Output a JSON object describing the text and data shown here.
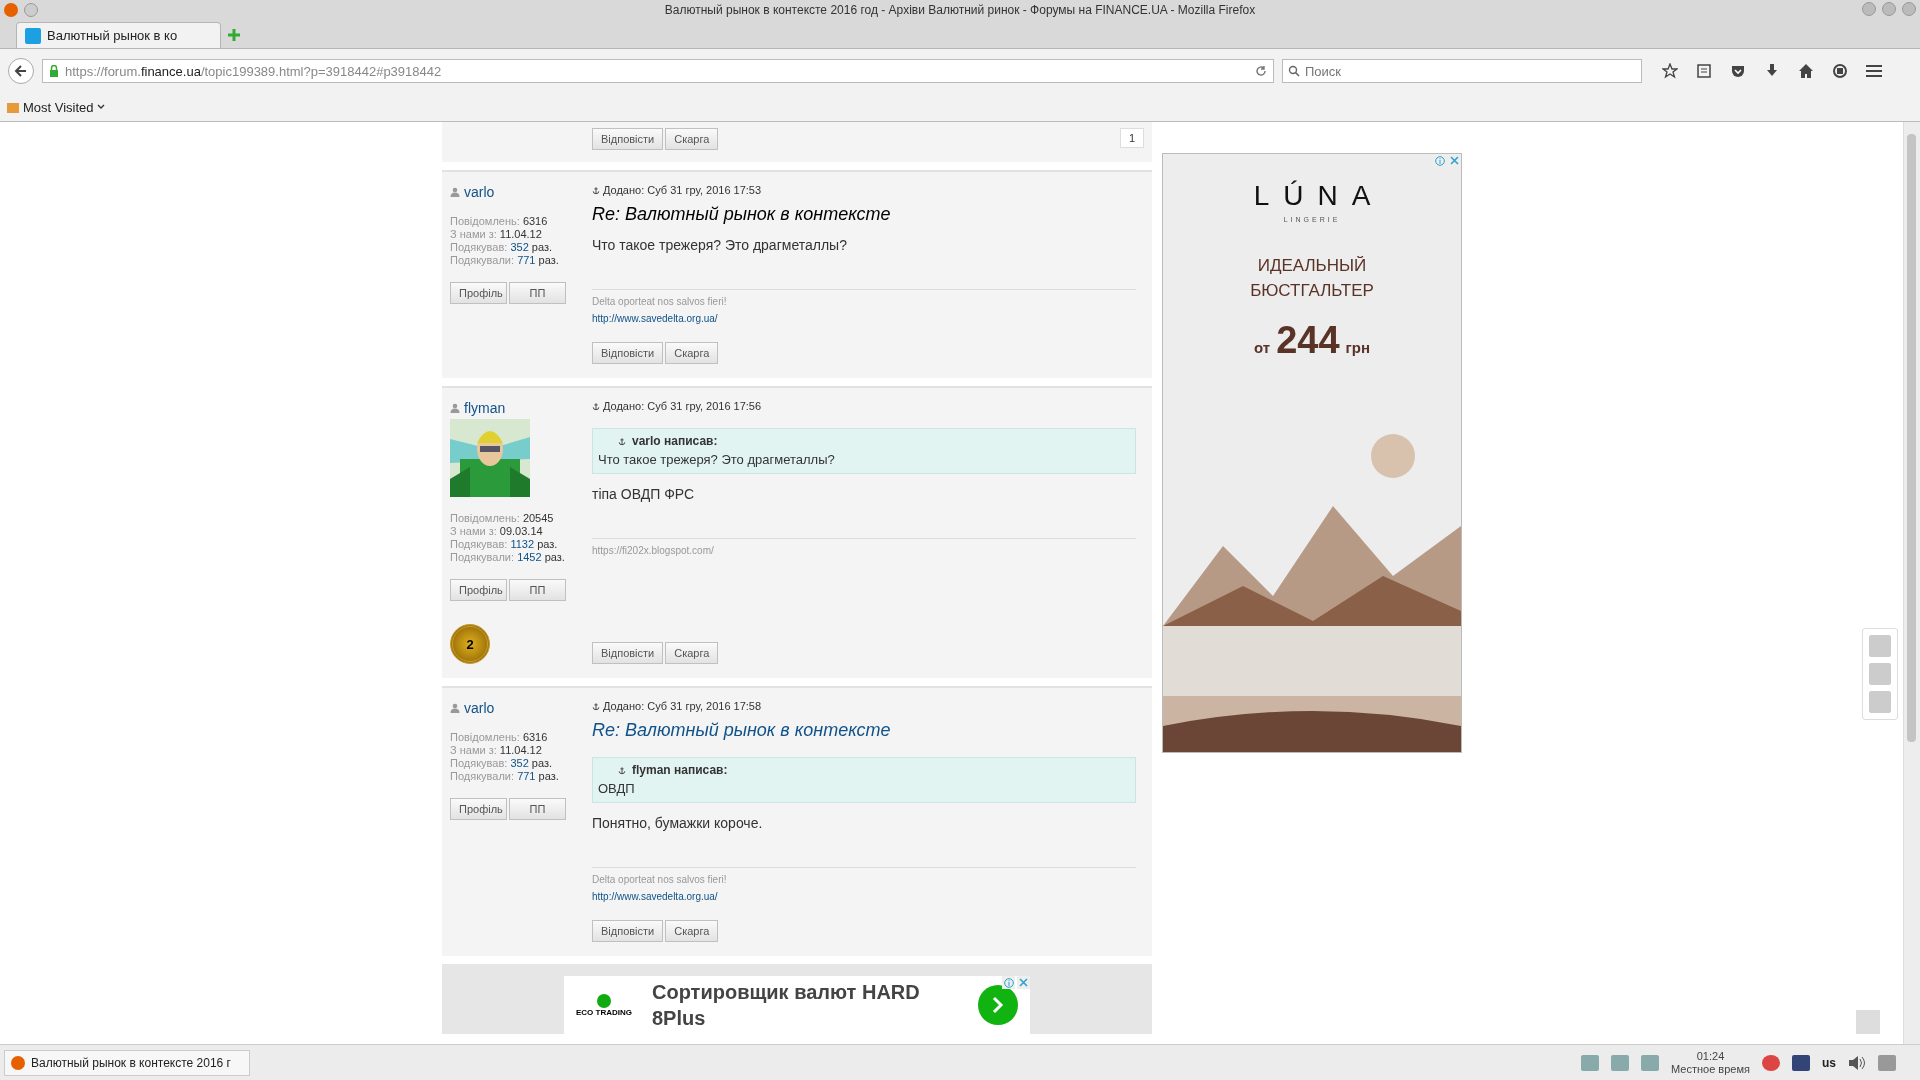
{
  "window": {
    "title": "Валютный рынок в контексте 2016 год - Архіви Валютний ринок - Форумы на FINANCE.UA - Mozilla Firefox"
  },
  "tabs": [
    {
      "label": "Валютный рынок в ко",
      "selected": true
    }
  ],
  "address_bar": {
    "prefix": "https://forum.",
    "domain": "finance.ua",
    "rest": "/topic199389.html?p=3918442#p3918442"
  },
  "search": {
    "placeholder": "Поиск"
  },
  "bookmarks": [
    {
      "label": "Most Visited"
    }
  ],
  "first_post": {
    "actions": [
      "Відповісти",
      "Скарга"
    ],
    "page": "1"
  },
  "posts": [
    {
      "author": "varlo",
      "stats": [
        {
          "label": "Повідомлень:",
          "value": "6316",
          "link": false
        },
        {
          "label": "З нами з:",
          "value": "11.04.12",
          "link": false
        },
        {
          "label": "Подякував:",
          "value": "352",
          "link": true,
          "suffix": "раз."
        },
        {
          "label": "Подякували:",
          "value": "771",
          "link": true,
          "suffix": "раз."
        }
      ],
      "buttons": [
        "Профіль",
        "ПП"
      ],
      "date": "Додано: Суб 31 гру, 2016 17:53",
      "title": {
        "text": "Re: Валютный рынок в контексте",
        "kind": "plain"
      },
      "body": "Что такое трежеря? Это драгметаллы?",
      "signature": {
        "text": "Delta oporteat nos salvos fieri!",
        "link": "http://www.savedelta.org.ua/"
      },
      "actions": [
        "Відповісти",
        "Скарга"
      ]
    },
    {
      "author": "flyman",
      "avatar": {
        "kind": "picture"
      },
      "stats": [
        {
          "label": "Повідомлень:",
          "value": "20545",
          "link": false
        },
        {
          "label": "З нами з:",
          "value": "09.03.14",
          "link": false
        },
        {
          "label": "Подякував:",
          "value": "1132",
          "link": true,
          "suffix": "раз."
        },
        {
          "label": "Подякували:",
          "value": "1452",
          "link": true,
          "suffix": "раз."
        }
      ],
      "buttons": [
        "Профіль",
        "ПП"
      ],
      "medal": "2",
      "date": "Додано: Суб 31 гру, 2016 17:56",
      "quote": {
        "author": "varlo написав:",
        "text": "Что такое трежеря? Это драгметаллы?"
      },
      "body": "тіпа ОВДП ФРС",
      "signature": {
        "text": "https://fi202x.blogspot.com/"
      },
      "actions": [
        "Відповісти",
        "Скарга"
      ]
    },
    {
      "author": "varlo",
      "stats": [
        {
          "label": "Повідомлень:",
          "value": "6316",
          "link": false
        },
        {
          "label": "З нами з:",
          "value": "11.04.12",
          "link": false
        },
        {
          "label": "Подякував:",
          "value": "352",
          "link": true,
          "suffix": "раз."
        },
        {
          "label": "Подякували:",
          "value": "771",
          "link": true,
          "suffix": "раз."
        }
      ],
      "buttons": [
        "Профіль",
        "ПП"
      ],
      "date": "Додано: Суб 31 гру, 2016 17:58",
      "title": {
        "text": "Re: Валютный рынок в контексте",
        "kind": "link"
      },
      "quote": {
        "author": "flyman написав:",
        "text": "ОВДП"
      },
      "body": "Понятно, бумажки короче.",
      "signature": {
        "text": "Delta oporteat nos salvos fieri!",
        "link": "http://www.savedelta.org.ua/"
      },
      "actions": [
        "Відповісти",
        "Скарга"
      ]
    }
  ],
  "side_ad": {
    "brand": "LÚNA",
    "brand_sub": "LINGERIE",
    "headline": [
      "ИДЕАЛЬНЫЙ",
      "БЮСТГАЛЬТЕР"
    ],
    "price_prefix": "от",
    "price": "244",
    "price_suffix": "грн",
    "image": {
      "kind": "picture"
    }
  },
  "bottom_ad": {
    "logo": "ECO TRADING",
    "text": "Сортировщик валют HARD 8Plus"
  },
  "taskbar": {
    "window": "Валютный рынок в контексте 2016 г",
    "layout": "us",
    "time": "01:24",
    "time_label": "Местное время"
  }
}
